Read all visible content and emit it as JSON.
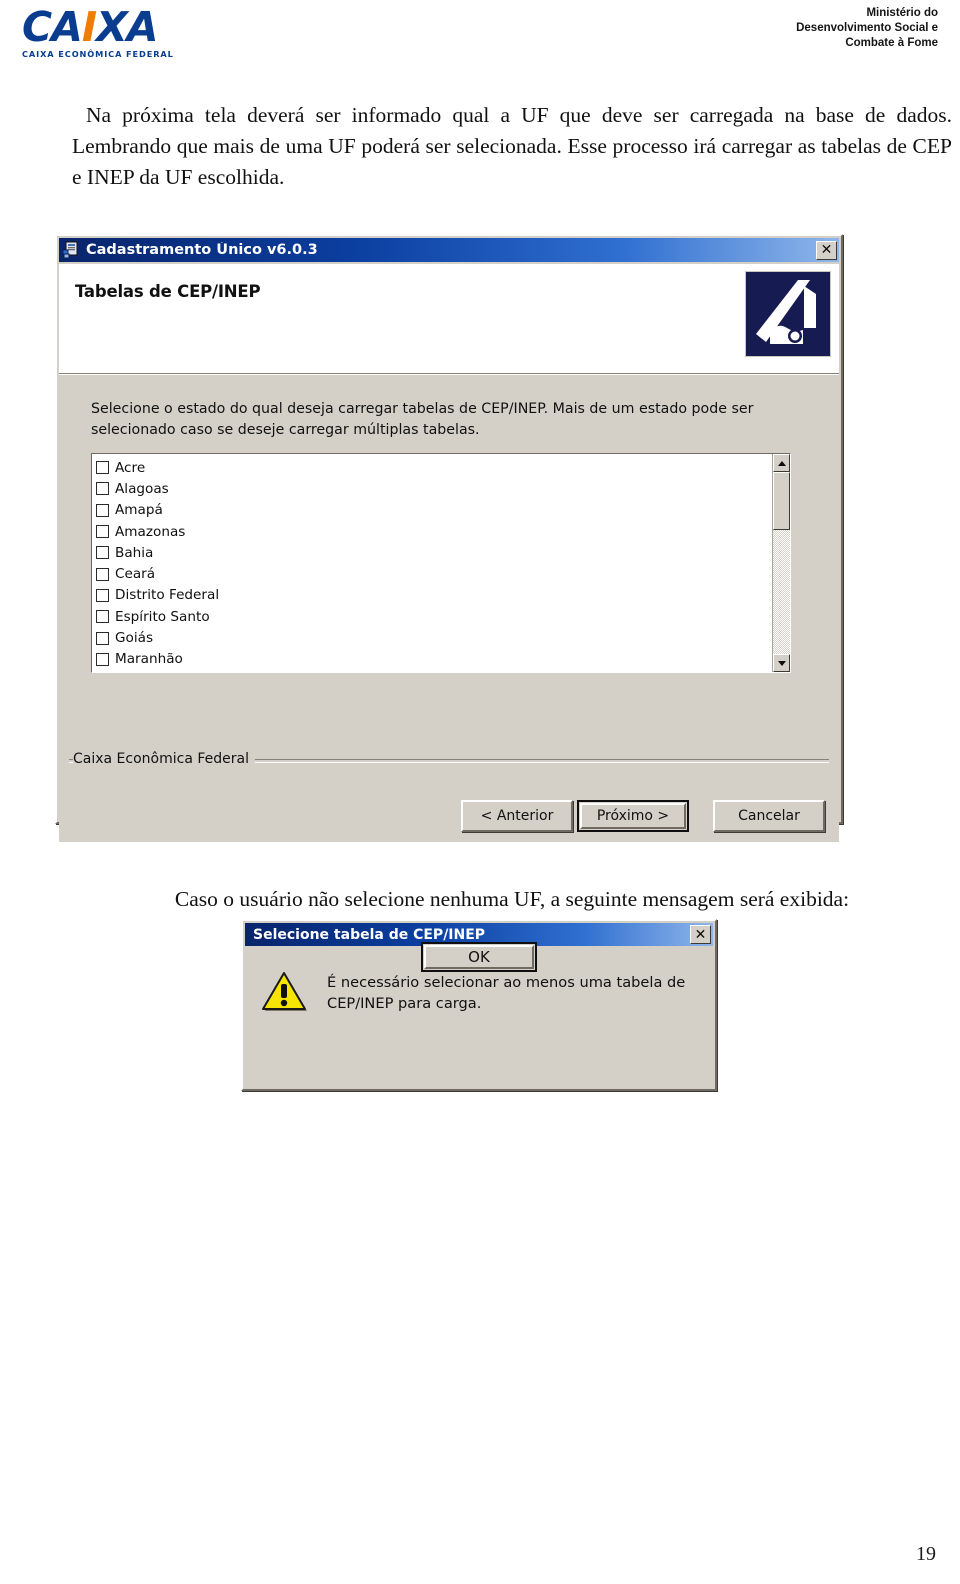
{
  "header": {
    "logo": {
      "wordmark_left": "CA",
      "wordmark_x": "I",
      "wordmark_right": "XA",
      "subtitle": "CAIXA ECONÔMICA FEDERAL"
    },
    "ministry_lines": [
      "Ministério do",
      "Desenvolvimento Social e",
      "Combate à Fome"
    ]
  },
  "paragraphs": {
    "intro": "Na próxima tela deverá ser informado qual a UF que deve ser carregada na base de dados.  Lembrando que mais de uma UF poderá ser selecionada.  Esse processo irá carregar as tabelas de CEP e INEP da UF escolhida.",
    "caption": "Caso o usuário não selecione nenhuma UF, a seguinte mensagem será exibida:"
  },
  "wizard": {
    "titlebar": {
      "title": "Cadastramento Único v6.0.3",
      "close_label": "✕"
    },
    "banner": {
      "title": "Tabelas de CEP/INEP"
    },
    "instructions": "Selecione o estado do qual deseja carregar tabelas de CEP/INEP. Mais de um estado pode ser selecionado caso se deseje carregar múltiplas tabelas.",
    "states": [
      {
        "label": "Acre",
        "checked": false
      },
      {
        "label": "Alagoas",
        "checked": false
      },
      {
        "label": "Amapá",
        "checked": false
      },
      {
        "label": "Amazonas",
        "checked": false
      },
      {
        "label": "Bahia",
        "checked": false
      },
      {
        "label": "Ceará",
        "checked": false
      },
      {
        "label": "Distrito Federal",
        "checked": false
      },
      {
        "label": "Espírito Santo",
        "checked": false
      },
      {
        "label": "Goiás",
        "checked": false
      },
      {
        "label": "Maranhão",
        "checked": false
      }
    ],
    "footer_label": "Caixa Econômica Federal",
    "buttons": {
      "back": "< Anterior",
      "next": "Próximo >",
      "cancel": "Cancelar"
    }
  },
  "msgbox": {
    "titlebar": {
      "title": "Selecione tabela de CEP/INEP",
      "close_label": "✕"
    },
    "message": "É necessário selecionar ao menos uma tabela de CEP/INEP para carga.",
    "ok_label": "OK"
  },
  "page_number": "19",
  "colors": {
    "caixa_blue": "#0a3d8f",
    "caixa_orange": "#f07d00",
    "titlebar_blue": "#0b3fa0",
    "dialog_face": "#d4d0c8",
    "warning_yellow": "#f5e500",
    "brand_navy": "#161b52"
  }
}
